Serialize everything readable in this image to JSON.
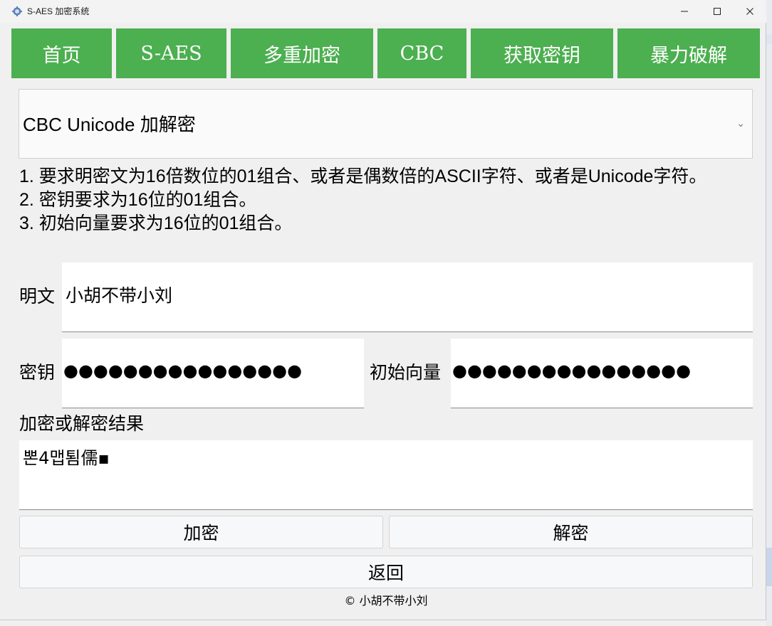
{
  "window": {
    "title": "S-AES 加密系统",
    "minimize_icon": "minimize-icon",
    "maximize_icon": "maximize-icon",
    "close_icon": "close-icon"
  },
  "nav": {
    "color": "#4caf50",
    "items": [
      {
        "label": "首页"
      },
      {
        "label": "S-AES"
      },
      {
        "label": "多重加密"
      },
      {
        "label": "CBC"
      },
      {
        "label": "获取密钥"
      },
      {
        "label": "暴力破解"
      }
    ]
  },
  "mode_select": {
    "value": "CBC Unicode 加解密"
  },
  "instructions": [
    "1. 要求明密文为16倍数位的01组合、或者是偶数倍的ASCII字符、或者是Unicode字符。",
    "2. 密钥要求为16位的01组合。",
    "3. 初始向量要求为16位的01组合。"
  ],
  "form": {
    "plaintext_label": "明文",
    "plaintext_value": "小胡不带小刘",
    "key_label": "密钥",
    "key_masked": "●●●●●●●●●●●●●●●●",
    "iv_label": "初始向量",
    "iv_masked": "●●●●●●●●●●●●●●●●",
    "result_label": "加密或解密结果",
    "result_value": "뽄4맵툄儒▪"
  },
  "buttons": {
    "encrypt": "加密",
    "decrypt": "解密",
    "back": "返回"
  },
  "footer": "© 小胡不带小刘"
}
